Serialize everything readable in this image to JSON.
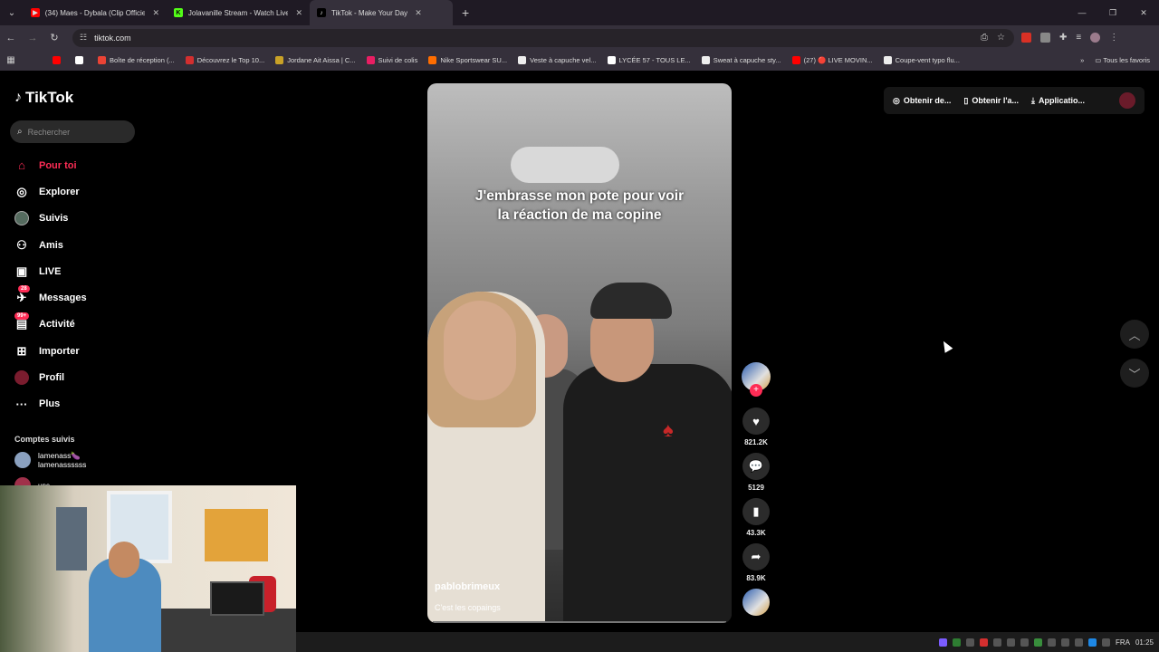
{
  "browser": {
    "tabs": [
      {
        "title": "(34) Maes - Dybala (Clip Officiel",
        "favicon_color": "#ff0000"
      },
      {
        "title": "Jolavanille Stream - Watch Live",
        "favicon_color": "#53fc18"
      },
      {
        "title": "TikTok - Make Your Day",
        "favicon_color": "#000000"
      }
    ],
    "url": "tiktok.com",
    "bookmarks": [
      "Boîte de réception (...",
      "Découvrez le Top 10...",
      "Jordane Ait Aissa | C...",
      "Suivi de colis",
      "Nike Sportswear SU...",
      "Veste à capuche vel...",
      "LYCÉE 57 - TOUS LE...",
      "Sweat à capuche sty...",
      "(27) 🔴 LIVE MOVIN...",
      "Coupe-vent typo flu..."
    ],
    "bookmarks_all": "Tous les favoris"
  },
  "tiktok": {
    "logo": "TikTok",
    "search_placeholder": "Rechercher",
    "nav": [
      {
        "label": "Pour toi",
        "icon": "home-icon"
      },
      {
        "label": "Explorer",
        "icon": "compass-icon"
      },
      {
        "label": "Suivis",
        "icon": "following-avatar-icon"
      },
      {
        "label": "Amis",
        "icon": "friends-icon"
      },
      {
        "label": "LIVE",
        "icon": "live-icon"
      },
      {
        "label": "Messages",
        "icon": "messages-icon",
        "badge": "28"
      },
      {
        "label": "Activité",
        "icon": "activity-icon",
        "badge": "99+"
      },
      {
        "label": "Importer",
        "icon": "upload-icon"
      },
      {
        "label": "Profil",
        "icon": "profile-icon"
      },
      {
        "label": "Plus",
        "icon": "more-icon"
      }
    ],
    "following_title": "Comptes suivis",
    "following": [
      {
        "name": "lamenass🍆",
        "handle": "lamenassssss"
      },
      {
        "name": "unc"
      }
    ],
    "top_actions": [
      "Obtenir de...",
      "Obtenir l'a...",
      "Applicatio..."
    ],
    "video": {
      "caption": "J'embrasse mon pote pour voir la réaction de ma copine",
      "author": "pablobrimeux",
      "description": "C'est les copaings",
      "likes": "821.2K",
      "comments": "5129",
      "saves": "43.3K",
      "shares": "83.9K"
    }
  },
  "taskbar": {
    "lang": "FRA",
    "time": "01:25"
  }
}
